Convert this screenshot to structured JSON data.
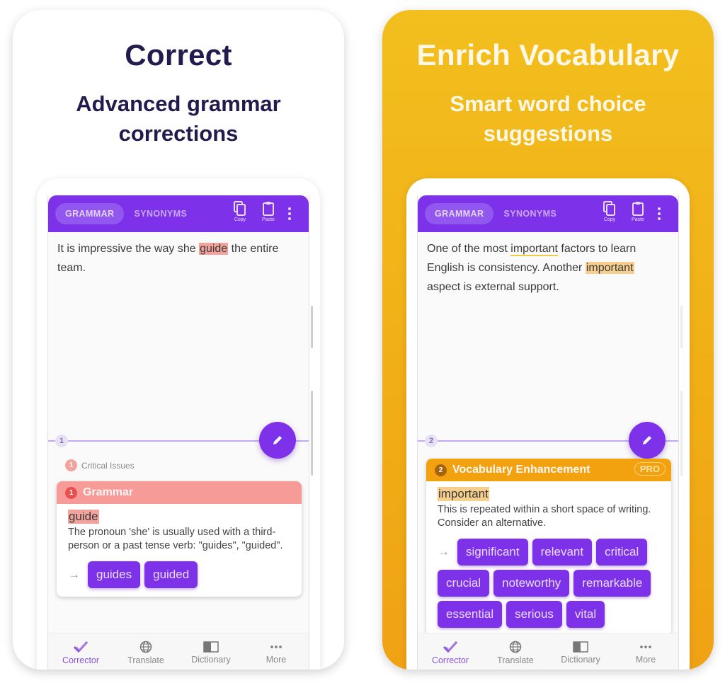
{
  "panels": [
    {
      "headline": "Correct",
      "subline": "Advanced grammar corrections",
      "app": {
        "tabs": [
          {
            "label": "GRAMMAR",
            "active": true
          },
          {
            "label": "SYNONYMS",
            "active": false
          }
        ],
        "toolbar": {
          "copy_label": "Copy",
          "paste_label": "Paste"
        },
        "editor": {
          "before": "It is impressive the way she ",
          "flagged": "guide",
          "after": " the entire team."
        },
        "issue_count": "1",
        "critical": {
          "count": "1",
          "label": "Critical Issues"
        },
        "card": {
          "count": "1",
          "title": "Grammar",
          "word": "guide",
          "description": "The pronoun 'she' is usually used with a third-person or a past tense verb: \"guides\", \"guided\".",
          "suggestions": [
            "guides",
            "guided"
          ]
        },
        "nav": [
          {
            "label": "Corrector",
            "icon": "check-icon",
            "active": true
          },
          {
            "label": "Translate",
            "icon": "globe-icon",
            "active": false
          },
          {
            "label": "Dictionary",
            "icon": "book-icon",
            "active": false
          },
          {
            "label": "More",
            "icon": "more-icon",
            "active": false
          }
        ]
      }
    },
    {
      "headline": "Enrich Vocabulary",
      "subline": "Smart word choice suggestions",
      "app": {
        "tabs": [
          {
            "label": "GRAMMAR",
            "active": true
          },
          {
            "label": "SYNONYMS",
            "active": false
          }
        ],
        "toolbar": {
          "copy_label": "Copy",
          "paste_label": "Paste"
        },
        "editor": {
          "part1": "One of the most ",
          "underlined": "important",
          "part2": " factors to learn English is consistency. Another ",
          "flagged": "important",
          "part3": " aspect is external support."
        },
        "issue_count": "2",
        "card": {
          "count": "2",
          "title": "Vocabulary Enhancement",
          "badge": "PRO",
          "word": "important",
          "description": "This is repeated within a short space of writing. Consider an alternative.",
          "suggestions": [
            "significant",
            "relevant",
            "critical",
            "crucial",
            "noteworthy",
            "remarkable",
            "essential",
            "serious",
            "vital"
          ]
        },
        "nav": [
          {
            "label": "Corrector",
            "icon": "check-icon",
            "active": true
          },
          {
            "label": "Translate",
            "icon": "globe-icon",
            "active": false
          },
          {
            "label": "Dictionary",
            "icon": "book-icon",
            "active": false
          },
          {
            "label": "More",
            "icon": "more-icon",
            "active": false
          }
        ]
      }
    }
  ],
  "colors": {
    "brand_purple": "#7d32ea",
    "grammar_red": "#f79b98",
    "vocab_orange": "#f2a20f",
    "yellow_bg": "#f2bb1d"
  }
}
